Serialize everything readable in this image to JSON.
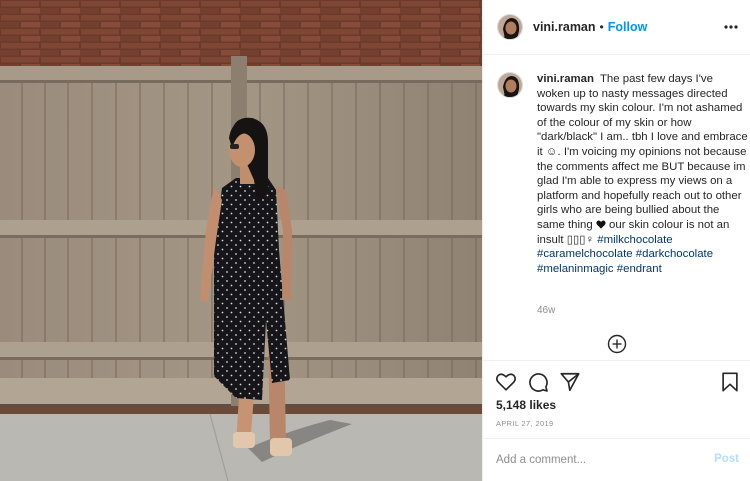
{
  "post": {
    "username": "vini.raman",
    "separator": "•",
    "follow_label": "Follow",
    "more_icon": "ellipsis-icon"
  },
  "caption": {
    "username": "vini.raman",
    "text_1": "The past few days I've woken up to nasty messages directed towards my skin colour. I'm not ashamed of the colour of my skin or how \"dark/black\" I am.. tbh I love and embrace it ☺. I'm voicing my opinions not because the comments affect me BUT because im glad I'm able to express my views on a platform and hopefully reach out to other girls who are being bullied about the same thing",
    "text_2": " our skin colour is not an insult ▯▯▯♀ ",
    "hashtags": [
      "#milkchocolate",
      "#caramelchocolate",
      "#darkchocolate",
      "#melaninmagic",
      "#endrant"
    ],
    "age": "46w"
  },
  "actions": {
    "like_icon": "heart-icon",
    "comment_icon": "comment-icon",
    "share_icon": "share-icon",
    "save_icon": "bookmark-icon",
    "likes": "5,148 likes",
    "date": "APRIL 27, 2019"
  },
  "comment": {
    "placeholder": "Add a comment...",
    "post_label": "Post"
  },
  "colors": {
    "link_blue": "#0095f6",
    "hashtag": "#00376b",
    "muted": "#8e8e8e",
    "post_disabled": "#b2dffc"
  }
}
